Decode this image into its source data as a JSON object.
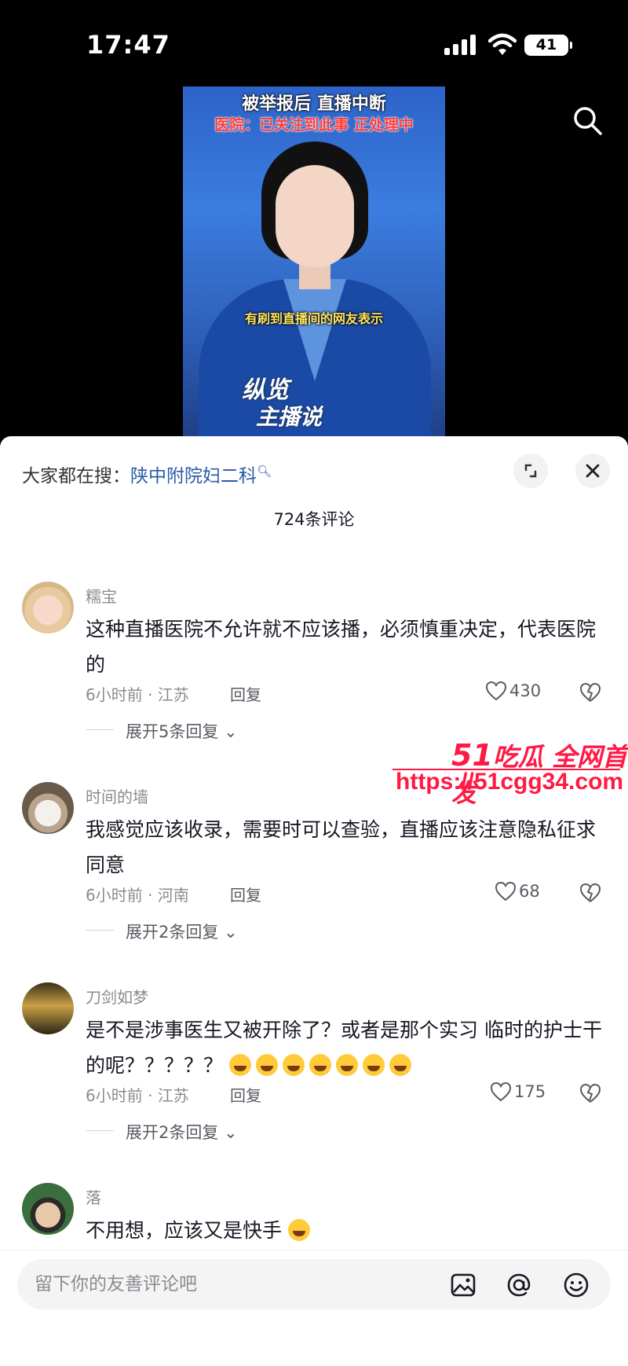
{
  "status_bar": {
    "time": "17:47",
    "battery": "41"
  },
  "video": {
    "headline": "被举报后 直播中断",
    "subheadline": "医院：已关注到此事 正处理中",
    "caption": "有刷到直播间的网友表示",
    "logo_line1": "纵览",
    "logo_line2": "主播说",
    "search_icon": "search-icon"
  },
  "sheet": {
    "trending_prefix": "大家都在搜：",
    "trending_link": "陕中附院妇二科",
    "comment_count": "724条评论",
    "expand_icon": "expand-icon",
    "close_icon": "close-icon"
  },
  "comments": [
    {
      "user": "糯宝",
      "text": "这种直播医院不允许就不应该播，必须慎重决定，代表医院的",
      "meta": "6小时前 · 江苏",
      "reply": "回复",
      "likes": "430",
      "expand": "展开5条回复"
    },
    {
      "user": "时间的墙",
      "text": "我感觉应该收录，需要时可以查验，直播应该注意隐私征求同意",
      "meta": "6小时前 · 河南",
      "reply": "回复",
      "likes": "68",
      "expand": "展开2条回复"
    },
    {
      "user": "刀剑如梦",
      "text": "是不是涉事医生又被开除了？或者是那个实习 临时的护士干的呢？？？？？",
      "meta": "6小时前 · 江苏",
      "reply": "回复",
      "likes": "175",
      "expand": "展开2条回复"
    },
    {
      "user": "落",
      "text": "不用想，应该又是快手"
    }
  ],
  "watermark": {
    "line1_num": "51",
    "line1_text": "吃瓜 全网首发",
    "line2": "https://51cgg34.com"
  },
  "input": {
    "placeholder": "留下你的友善评论吧"
  },
  "colors": {
    "accent_link": "#2b5ba7",
    "watermark": "#ff1a45",
    "muted": "#8a8b91"
  }
}
